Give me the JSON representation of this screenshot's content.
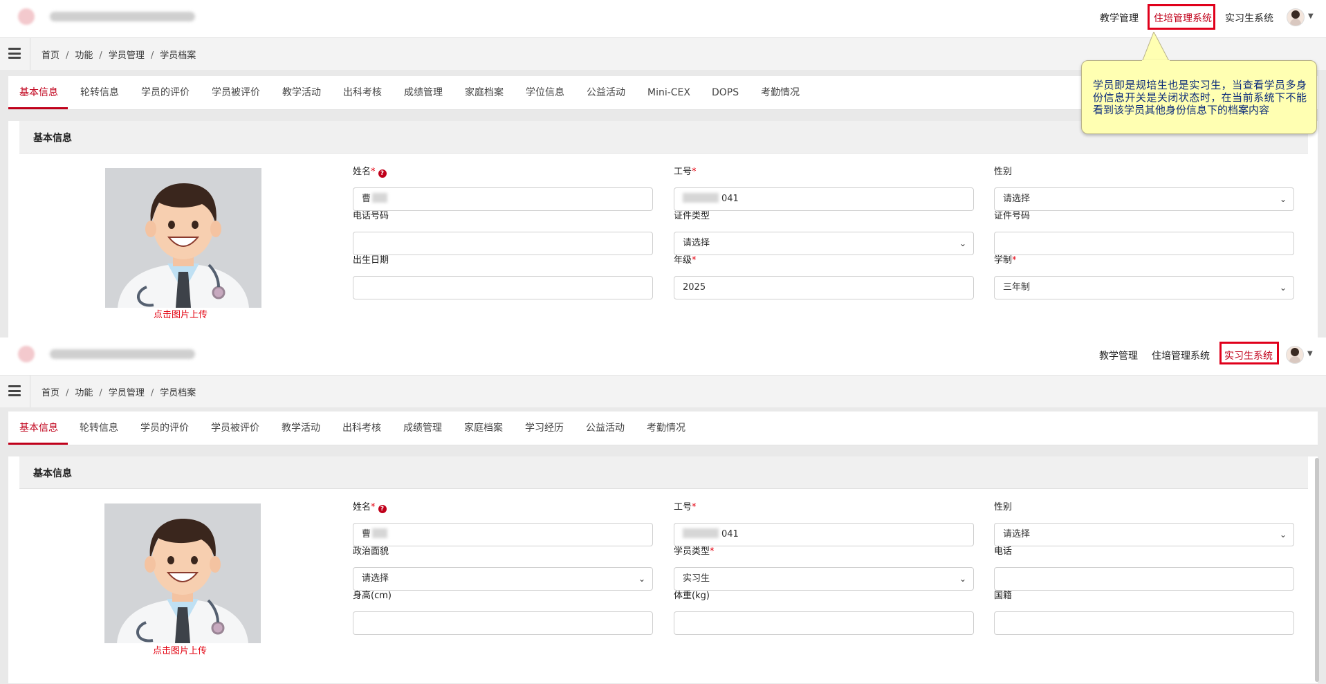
{
  "panels": [
    {
      "logo_label": "",
      "nav": [
        "教学管理",
        "住培管理系统",
        "实习生系统"
      ],
      "active_nav_index": 1,
      "breadcrumb": [
        "首页",
        "功能",
        "学员管理",
        "学员档案"
      ],
      "tabs": [
        "基本信息",
        "轮转信息",
        "学员的评价",
        "学员被评价",
        "教学活动",
        "出科考核",
        "成绩管理",
        "家庭档案",
        "学位信息",
        "公益活动",
        "Mini-CEX",
        "DOPS",
        "考勤情况"
      ],
      "active_tab_index": 0,
      "section_title": "基本信息",
      "upload_label": "点击图片上传",
      "fields": [
        {
          "label": "姓名",
          "required": true,
          "help": true,
          "value": "曹",
          "type": "text",
          "blur": "after"
        },
        {
          "label": "工号",
          "required": true,
          "help": false,
          "value": "041",
          "type": "text",
          "blur": "before"
        },
        {
          "label": "性别",
          "required": false,
          "help": false,
          "value": "请选择",
          "type": "select"
        },
        {
          "label": "电话号码",
          "required": false,
          "help": false,
          "value": "",
          "type": "text"
        },
        {
          "label": "证件类型",
          "required": false,
          "help": false,
          "value": "请选择",
          "type": "select"
        },
        {
          "label": "证件号码",
          "required": false,
          "help": false,
          "value": "",
          "type": "text"
        },
        {
          "label": "出生日期",
          "required": false,
          "help": false,
          "value": "",
          "type": "text"
        },
        {
          "label": "年级",
          "required": true,
          "help": false,
          "value": "2025",
          "type": "text"
        },
        {
          "label": "学制",
          "required": true,
          "help": false,
          "value": "三年制",
          "type": "select"
        }
      ]
    },
    {
      "logo_label": "",
      "nav": [
        "教学管理",
        "住培管理系统",
        "实习生系统"
      ],
      "active_nav_index": 2,
      "breadcrumb": [
        "首页",
        "功能",
        "学员管理",
        "学员档案"
      ],
      "tabs": [
        "基本信息",
        "轮转信息",
        "学员的评价",
        "学员被评价",
        "教学活动",
        "出科考核",
        "成绩管理",
        "家庭档案",
        "学习经历",
        "公益活动",
        "考勤情况"
      ],
      "active_tab_index": 0,
      "section_title": "基本信息",
      "upload_label": "点击图片上传",
      "fields": [
        {
          "label": "姓名",
          "required": true,
          "help": true,
          "value": "曹",
          "type": "text",
          "blur": "after"
        },
        {
          "label": "工号",
          "required": true,
          "help": false,
          "value": "041",
          "type": "text",
          "blur": "before"
        },
        {
          "label": "性别",
          "required": false,
          "help": false,
          "value": "请选择",
          "type": "select"
        },
        {
          "label": "政治面貌",
          "required": false,
          "help": false,
          "value": "请选择",
          "type": "select"
        },
        {
          "label": "学员类型",
          "required": true,
          "help": false,
          "value": "实习生",
          "type": "select"
        },
        {
          "label": "电话",
          "required": false,
          "help": false,
          "value": "",
          "type": "text"
        },
        {
          "label": "身高(cm)",
          "required": false,
          "help": false,
          "value": "",
          "type": "text"
        },
        {
          "label": "体重(kg)",
          "required": false,
          "help": false,
          "value": "",
          "type": "text"
        },
        {
          "label": "国籍",
          "required": false,
          "help": false,
          "value": "",
          "type": "text"
        }
      ]
    }
  ],
  "tooltip": {
    "text": "学员即是规培生也是实习生，当查看学员多身份信息开关是关闭状态时，在当前系统下不能看到该学员其他身份信息下的档案内容"
  },
  "colors": {
    "accent": "#c0001a",
    "highlight_box": "#e0001b",
    "required": "#e3000f",
    "tooltip_bg": "#ffffb2"
  },
  "icons": {
    "menu": "hamburger-icon",
    "help": "question-circle-icon",
    "select": "chevron-down-icon",
    "user": "user-avatar-icon"
  }
}
